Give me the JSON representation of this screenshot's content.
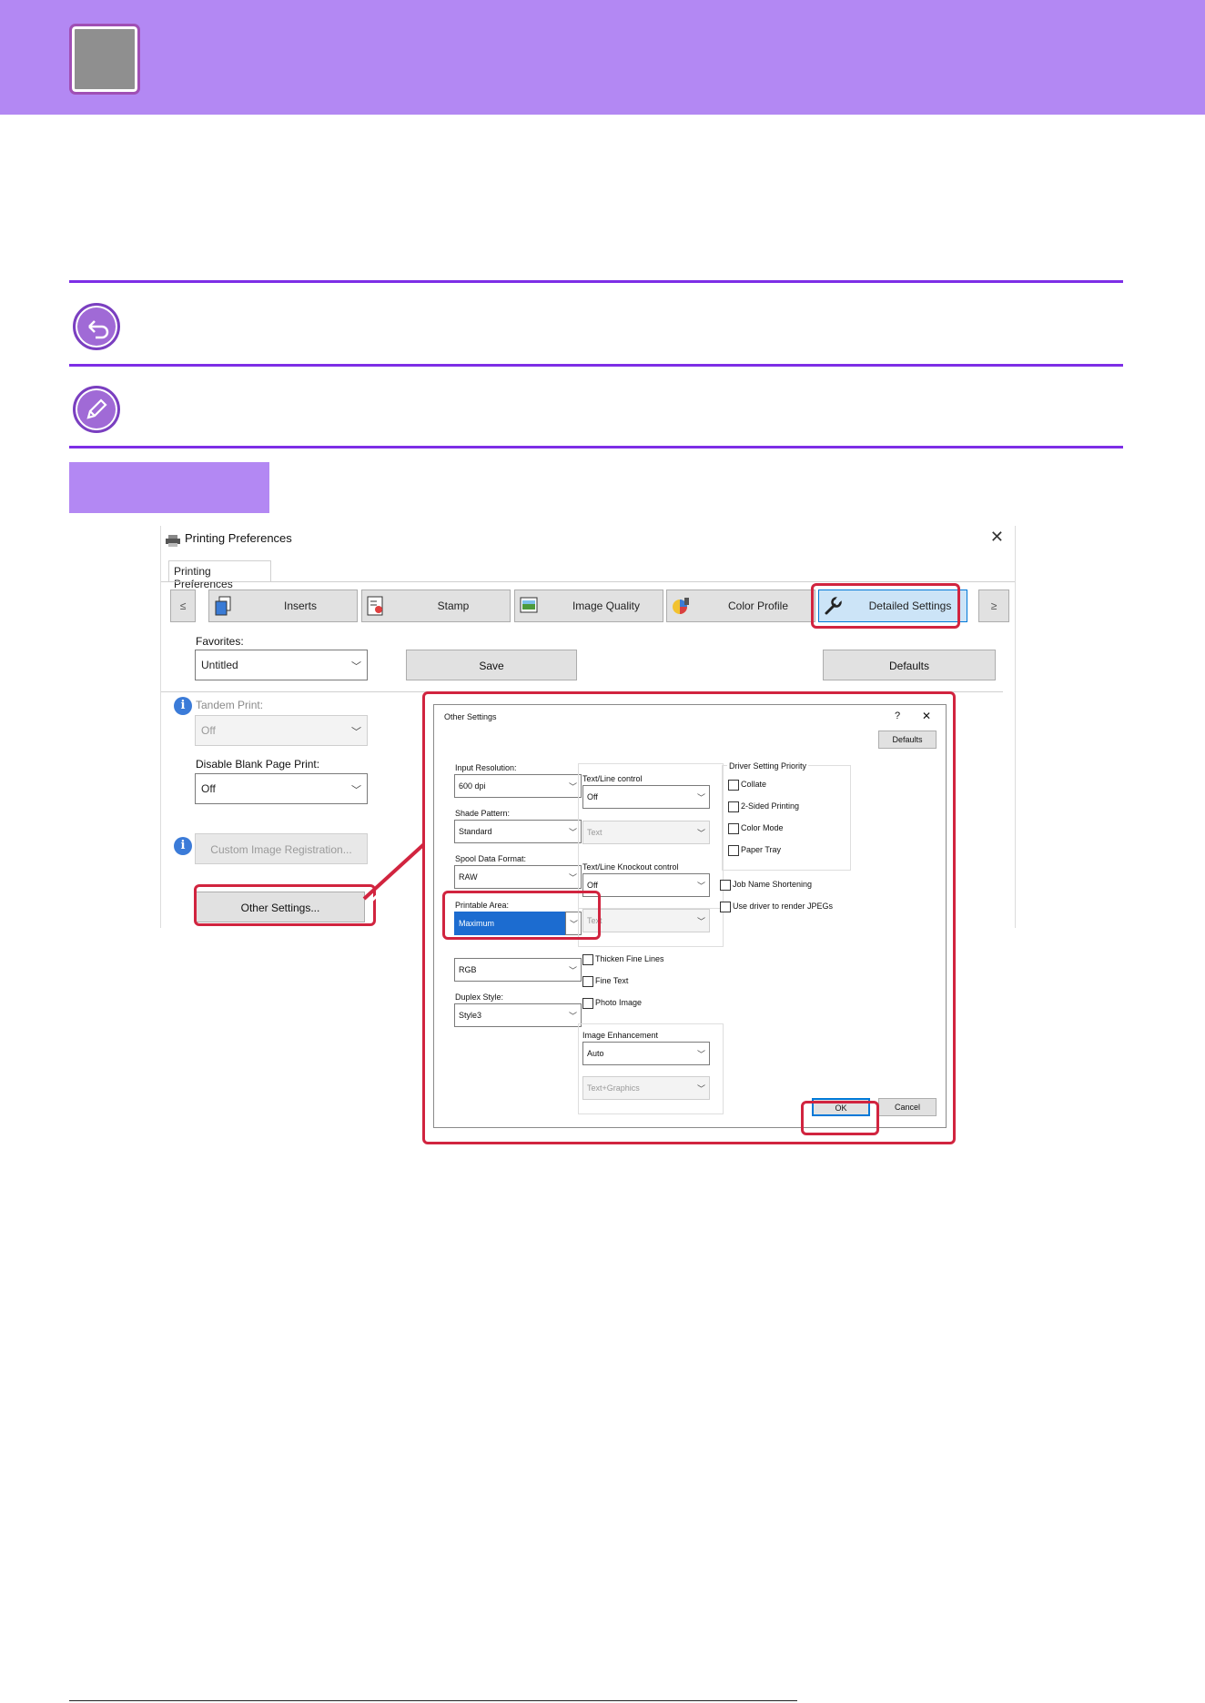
{
  "window": {
    "title": "Printing Preferences",
    "close_glyph": "✕",
    "tab_label": "Printing Preferences",
    "nav_prev": "≤",
    "nav_next": "≥",
    "tabs": [
      {
        "label": "Inserts",
        "icon": "inserts-icon"
      },
      {
        "label": "Stamp",
        "icon": "stamp-icon"
      },
      {
        "label": "Image Quality",
        "icon": "image-quality-icon"
      },
      {
        "label": "Color Profile",
        "icon": "color-profile-icon"
      },
      {
        "label": "Detailed Settings",
        "icon": "wrench-icon"
      }
    ],
    "favorites_label": "Favorites:",
    "favorites_value": "Untitled",
    "save_label": "Save",
    "defaults_label": "Defaults",
    "tandem_label": "Tandem Print:",
    "tandem_value": "Off",
    "blank_label": "Disable Blank Page Print:",
    "blank_value": "Off",
    "custom_image_label": "Custom Image Registration...",
    "other_settings_label": "Other Settings..."
  },
  "dialog": {
    "title": "Other Settings",
    "help_glyph": "?",
    "close_glyph": "✕",
    "defaults_label": "Defaults",
    "input_resolution_label": "Input Resolution:",
    "input_resolution_value": "600 dpi",
    "shade_pattern_label": "Shade Pattern:",
    "shade_pattern_value": "Standard",
    "spool_format_label": "Spool Data Format:",
    "spool_format_value": "RAW",
    "printable_area_label": "Printable Area:",
    "printable_area_value": "Maximum",
    "rip_style_value": "RGB",
    "duplex_style_label": "Duplex Style:",
    "duplex_style_value": "Style3",
    "text_line_control_label": "Text/Line control",
    "text_line_control_value": "Off",
    "text_line_sub_value": "Text",
    "knockout_label": "Text/Line Knockout control",
    "knockout_value": "Off",
    "knockout_sub_value": "Text",
    "thicken_lines_label": "Thicken Fine Lines",
    "fine_text_label": "Fine Text",
    "photo_image_label": "Photo Image",
    "image_enhancement_label": "Image Enhancement",
    "image_enhancement_value": "Auto",
    "image_enhancement_sub_value": "Text+Graphics",
    "driver_priority_label": "Driver Setting Priority",
    "collate_label": "Collate",
    "two_sided_label": "2-Sided Printing",
    "color_mode_label": "Color Mode",
    "paper_tray_label": "Paper Tray",
    "job_name_label": "Job Name Shortening",
    "render_jpeg_label": "Use driver to render JPEGs",
    "ok_label": "OK",
    "cancel_label": "Cancel"
  },
  "colors": {
    "header": "#b388f3",
    "rule": "#7d2ee6",
    "highlight": "#d1243f"
  }
}
